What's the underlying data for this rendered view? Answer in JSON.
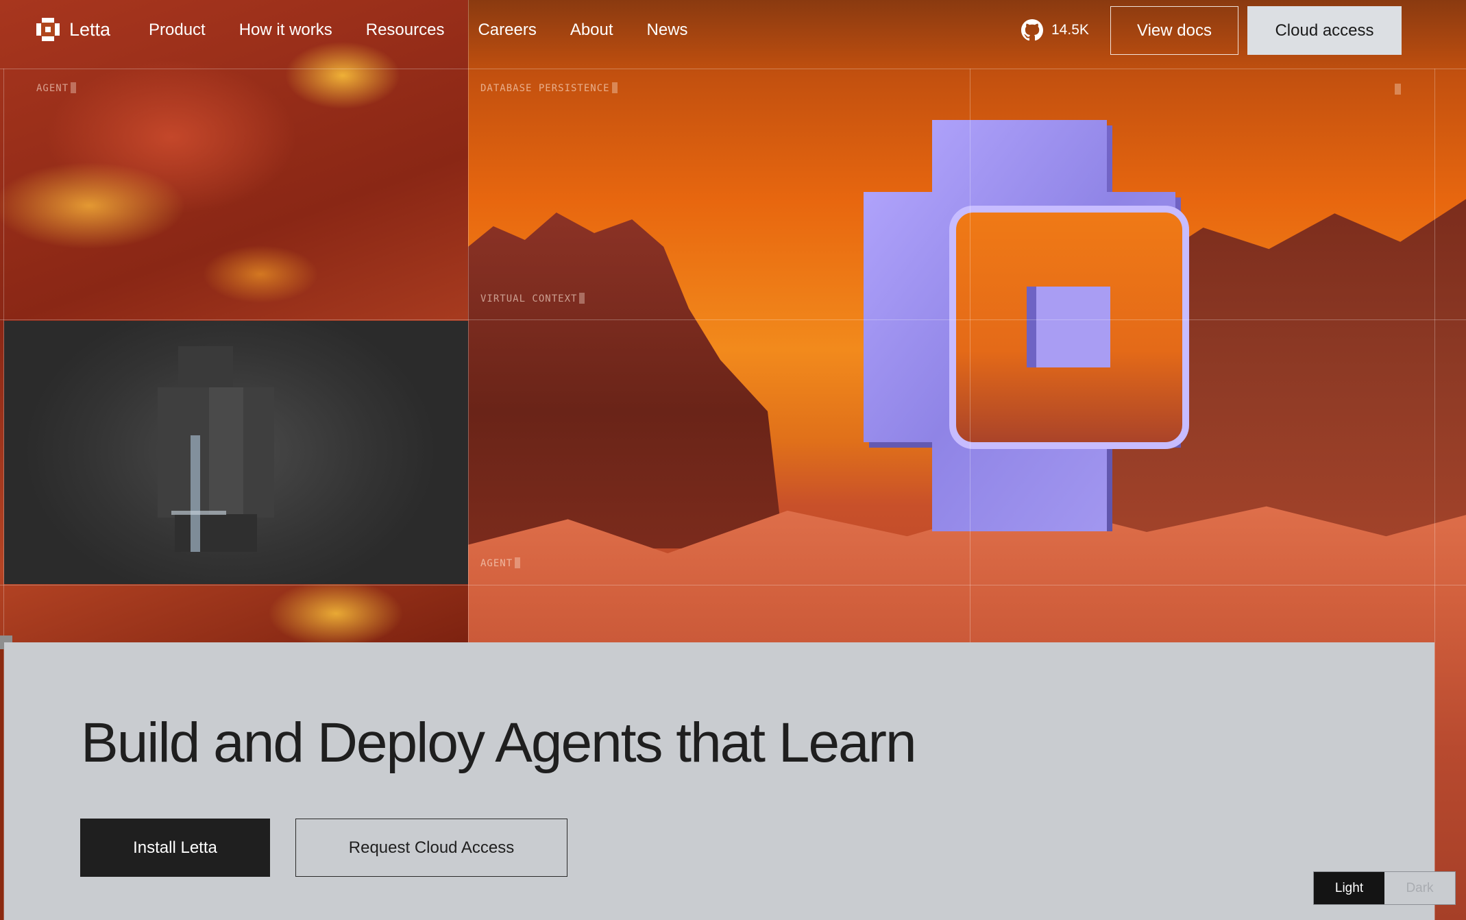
{
  "nav": {
    "brand": "Letta",
    "links": [
      "Product",
      "How it works",
      "Resources",
      "Careers",
      "About",
      "News"
    ],
    "github_stars": "14.5K",
    "view_docs": "View docs",
    "cloud_access": "Cloud access"
  },
  "scene": {
    "labels": {
      "agent_top": "AGENT",
      "database": "DATABASE PERSISTENCE",
      "virtual_context": "VIRTUAL CONTEXT",
      "agent_bottom": "AGENT"
    }
  },
  "hero": {
    "title": "Build and Deploy Agents that Learn",
    "install_button": "Install Letta",
    "request_button": "Request Cloud Access"
  },
  "theme": {
    "light": "Light",
    "dark": "Dark",
    "selected": "Light"
  },
  "icons": [
    "letta-logo-icon",
    "github-icon"
  ],
  "colors": {
    "hero_background": "#c9ccd0",
    "primary_button": "#1f1f1f",
    "cloud_button": "#dcdfe3",
    "sky_orange": "#f28a1c",
    "logo_purple": "#9a8ff0"
  }
}
